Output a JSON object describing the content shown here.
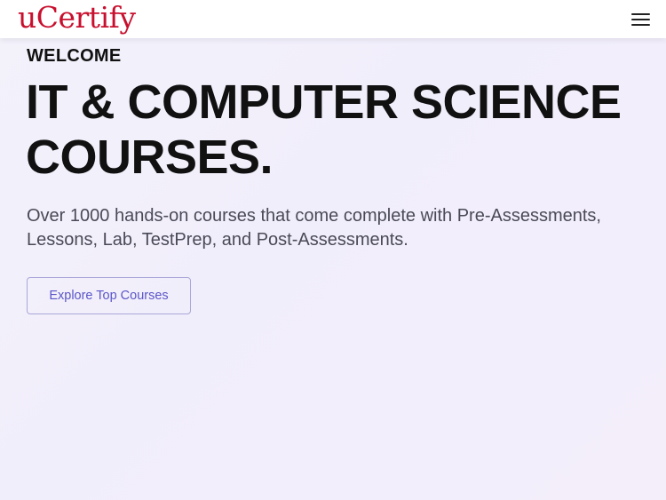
{
  "header": {
    "logo_text": "uCertify",
    "menu_icon": "hamburger-menu-icon"
  },
  "hero": {
    "eyebrow": "WELCOME",
    "title_line1": "IT & COMPUTER SCIENCE",
    "title_line2": "COURSES.",
    "description_line1": "Over 1000 hands-on courses that come complete with Pre-Assessments,",
    "description_line2": "Lessons, Lab, TestPrep, and Post-Assessments.",
    "cta_label": "Explore Top Courses"
  },
  "colors": {
    "brand": "#c8102e",
    "accent": "#5b56c9",
    "text": "#111111",
    "muted_text": "#4a4a57"
  }
}
